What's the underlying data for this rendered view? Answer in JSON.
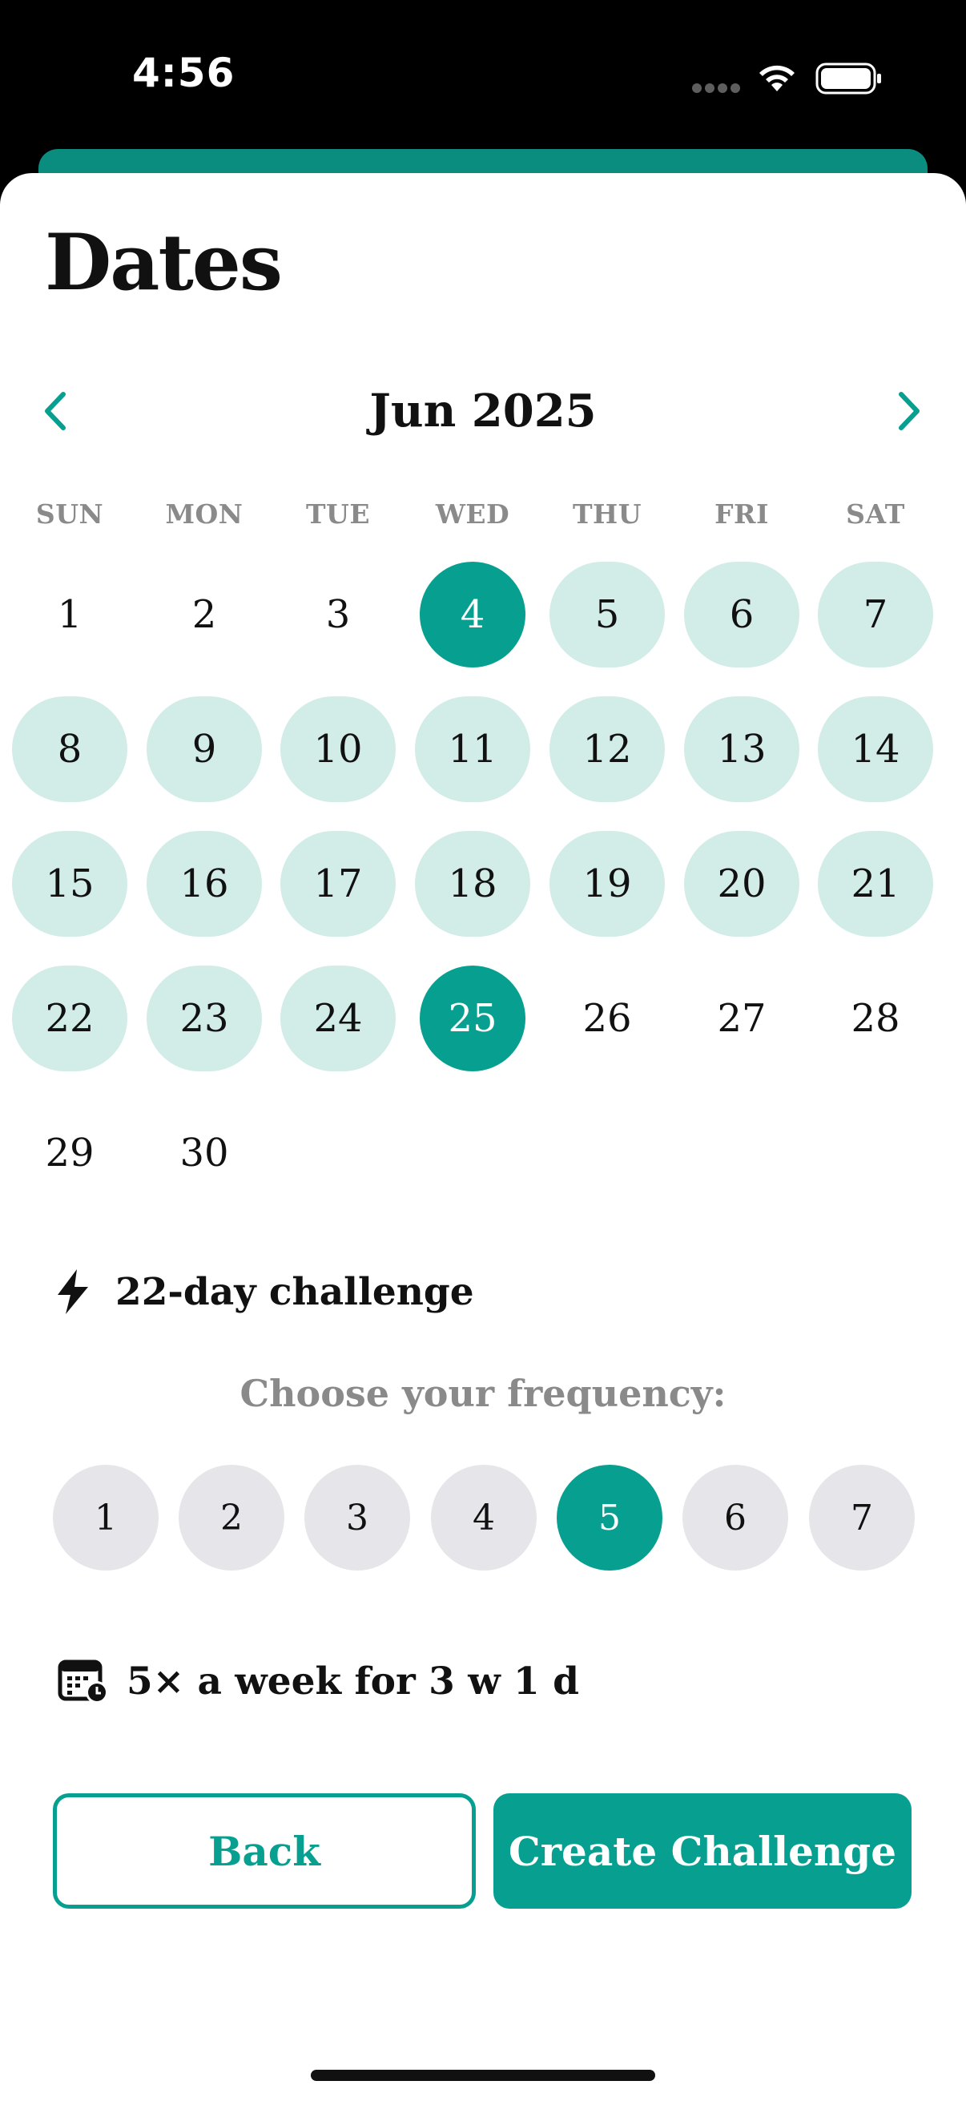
{
  "status_bar": {
    "time": "4:56",
    "icons": [
      "cellular-dots-icon",
      "wifi-icon",
      "battery-icon"
    ]
  },
  "sheet": {
    "title": "Dates"
  },
  "calendar": {
    "month_label": "Jun 2025",
    "prev_icon": "chevron-left-icon",
    "next_icon": "chevron-right-icon",
    "weekdays": [
      "SUN",
      "MON",
      "TUE",
      "WED",
      "THU",
      "FRI",
      "SAT"
    ],
    "days": [
      "1",
      "2",
      "3",
      "4",
      "5",
      "6",
      "7",
      "8",
      "9",
      "10",
      "11",
      "12",
      "13",
      "14",
      "15",
      "16",
      "17",
      "18",
      "19",
      "20",
      "21",
      "22",
      "23",
      "24",
      "25",
      "26",
      "27",
      "28",
      "29",
      "30"
    ],
    "range_start": "4",
    "range_end": "25"
  },
  "challenge": {
    "icon": "lightning-bolt-icon",
    "text": "22-day challenge"
  },
  "frequency": {
    "label": "Choose your frequency:",
    "options": [
      "1",
      "2",
      "3",
      "4",
      "5",
      "6",
      "7"
    ],
    "selected": "5"
  },
  "schedule": {
    "icon": "calendar-clock-icon",
    "text": "5× a week for 3 w 1 d"
  },
  "actions": {
    "back_label": "Back",
    "create_label": "Create Challenge"
  },
  "colors": {
    "accent": "#07a090",
    "range_fill": "#d2ece8",
    "chip_gray": "#e6e6ea",
    "muted_text": "#8a8a8a"
  }
}
